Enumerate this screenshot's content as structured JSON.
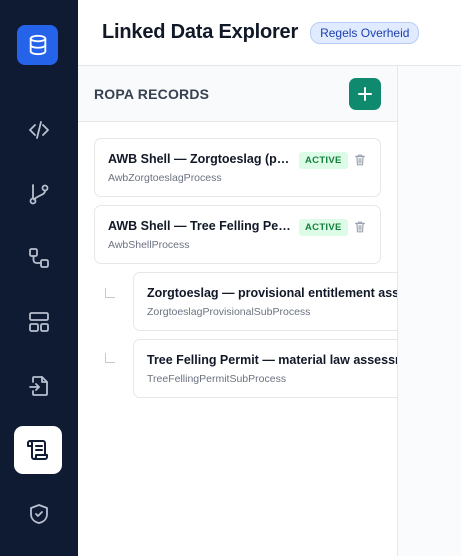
{
  "header": {
    "title": "Linked Data Explorer",
    "badge": "Regels Overheid"
  },
  "rail": {
    "items": [
      {
        "icon": "database-icon"
      },
      {
        "icon": "code-icon"
      },
      {
        "icon": "git-branch-icon"
      },
      {
        "icon": "workflow-icon"
      },
      {
        "icon": "layout-icon"
      },
      {
        "icon": "file-import-icon"
      },
      {
        "icon": "scroll-icon",
        "active": true
      },
      {
        "icon": "shield-check-icon"
      }
    ]
  },
  "panel": {
    "title": "ROPA RECORDS",
    "add_icon": "plus-icon",
    "records": [
      {
        "name": "AWB Shell — Zorgtoeslag (provisional entitlement)",
        "id": "AwbZorgtoeslagProcess",
        "status": "ACTIVE"
      },
      {
        "name": "AWB Shell — Tree Felling Permit",
        "id": "AwbShellProcess",
        "status": "ACTIVE"
      }
    ],
    "subprocesses": [
      {
        "name": "Zorgtoeslag — provisional entitlement assessment",
        "id": "ZorgtoeslagProvisionalSubProcess"
      },
      {
        "name": "Tree Felling Permit — material law assessment",
        "id": "TreeFellingPermitSubProcess"
      }
    ]
  },
  "colors": {
    "rail_bg": "#0f1b33",
    "accent_blue": "#2563eb",
    "accent_green": "#0f8a6e",
    "status_green": "#15803d"
  }
}
